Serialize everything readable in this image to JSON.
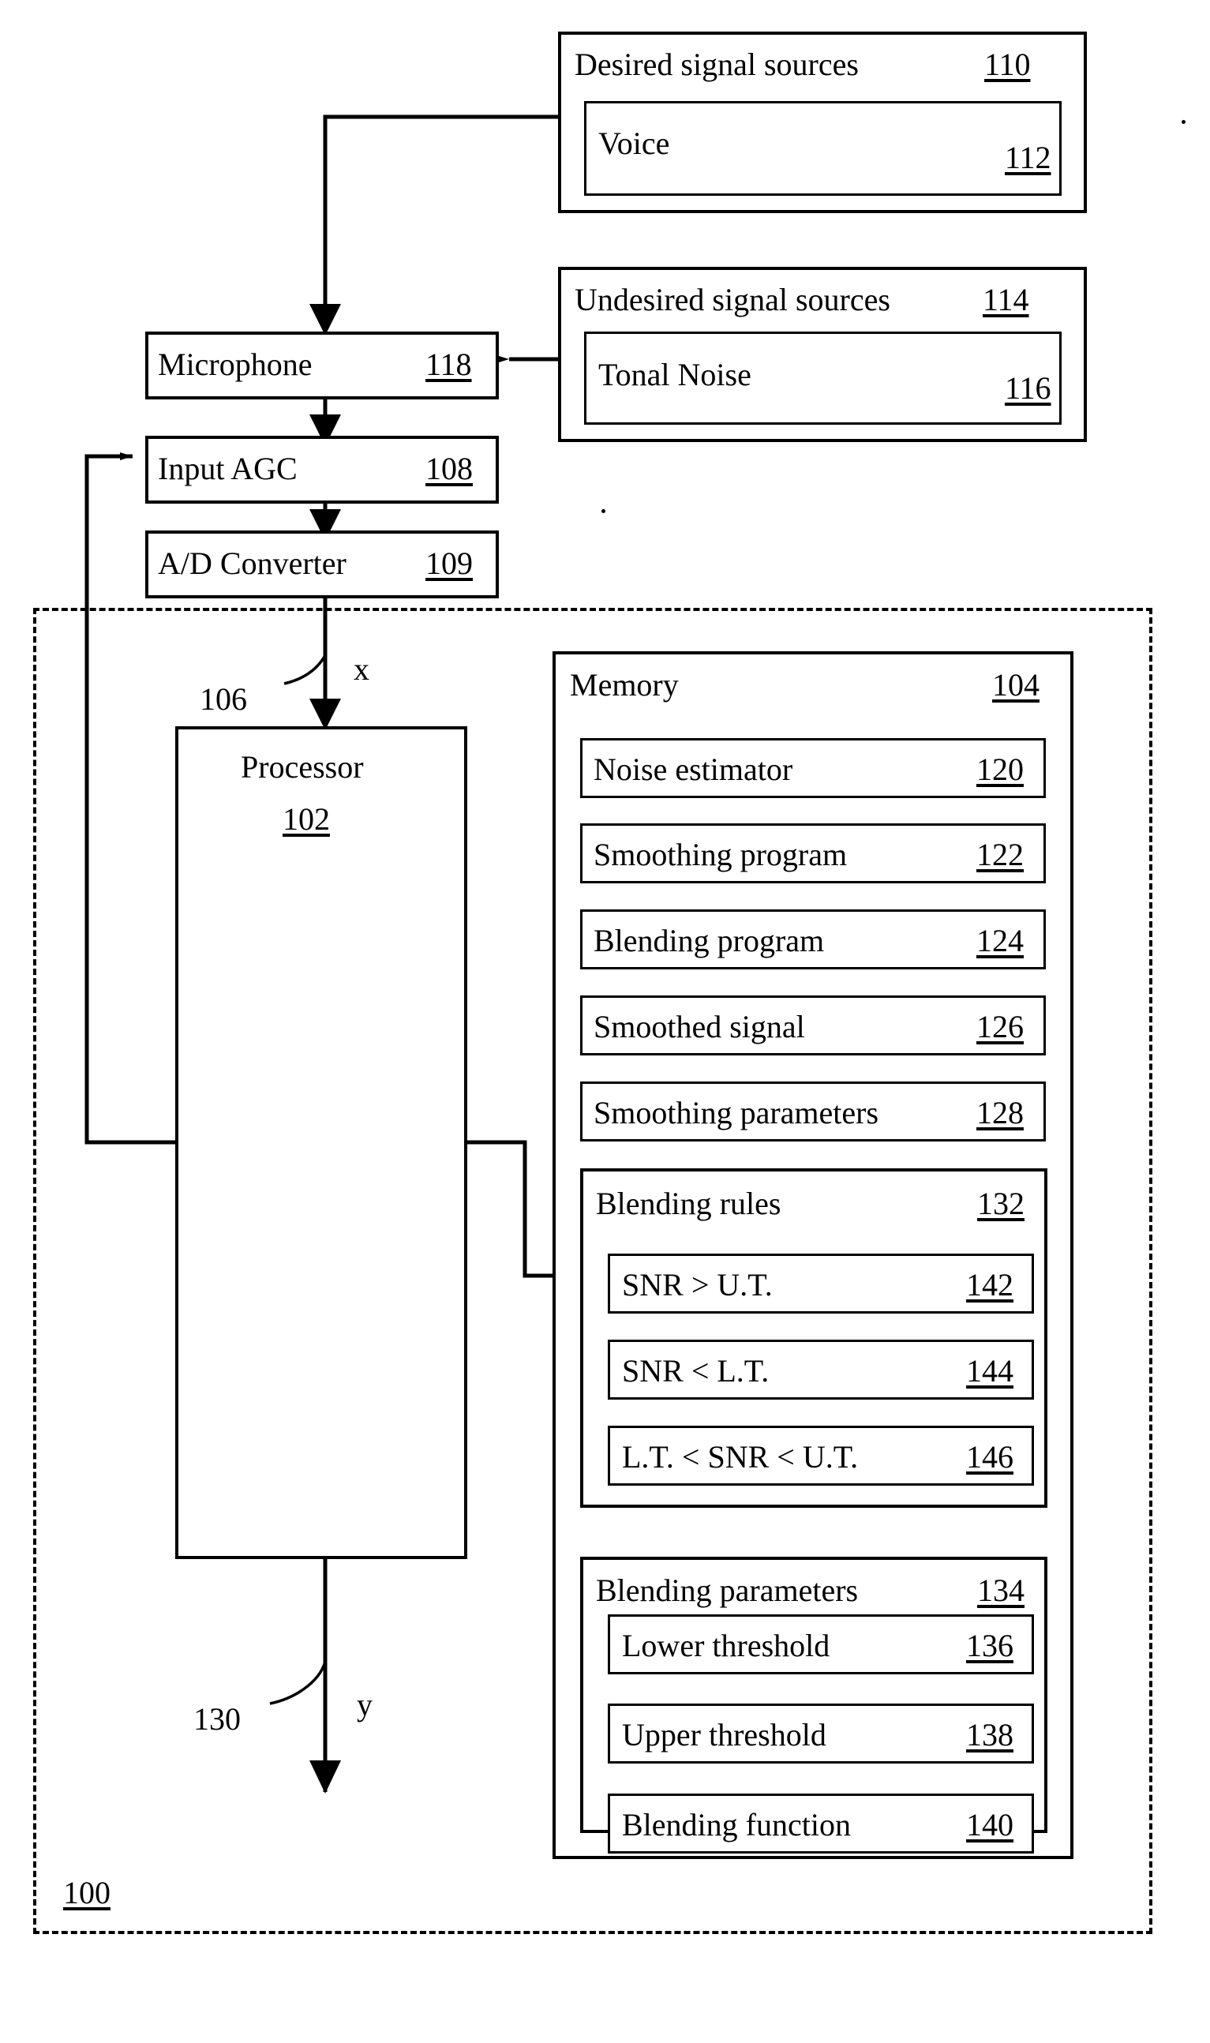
{
  "figure": {
    "system_ref": "100",
    "signal_in_label": "x",
    "signal_in_ref": "106",
    "signal_out_label": "y",
    "signal_out_ref": "130"
  },
  "desired_sources": {
    "title": "Desired signal sources",
    "ref": "110",
    "inner": {
      "title": "Voice",
      "ref": "112",
      "waveform": "voice-envelope"
    }
  },
  "undesired_sources": {
    "title": "Undesired signal sources",
    "ref": "114",
    "inner": {
      "title": "Tonal Noise",
      "ref": "116",
      "waveform": "tonal-noise-spikes"
    }
  },
  "chain": [
    {
      "title": "Microphone",
      "ref": "118"
    },
    {
      "title": "Input AGC",
      "ref": "108"
    },
    {
      "title": "A/D Converter",
      "ref": "109"
    }
  ],
  "processor": {
    "title": "Processor",
    "ref": "102"
  },
  "memory": {
    "title": "Memory",
    "ref": "104",
    "items": [
      {
        "title": "Noise estimator",
        "ref": "120"
      },
      {
        "title": "Smoothing program",
        "ref": "122"
      },
      {
        "title": "Blending program",
        "ref": "124"
      },
      {
        "title": "Smoothed signal",
        "ref": "126"
      },
      {
        "title": "Smoothing parameters",
        "ref": "128"
      }
    ],
    "blending_rules": {
      "title": "Blending rules",
      "ref": "132",
      "items": [
        {
          "title": "SNR > U.T.",
          "ref": "142"
        },
        {
          "title": "SNR < L.T.",
          "ref": "144"
        },
        {
          "title": "L.T. < SNR < U.T.",
          "ref": "146"
        }
      ]
    },
    "blending_parameters": {
      "title": "Blending parameters",
      "ref": "134",
      "items": [
        {
          "title": "Lower threshold",
          "ref": "136"
        },
        {
          "title": "Upper threshold",
          "ref": "138"
        },
        {
          "title": "Blending function",
          "ref": "140"
        }
      ]
    }
  }
}
